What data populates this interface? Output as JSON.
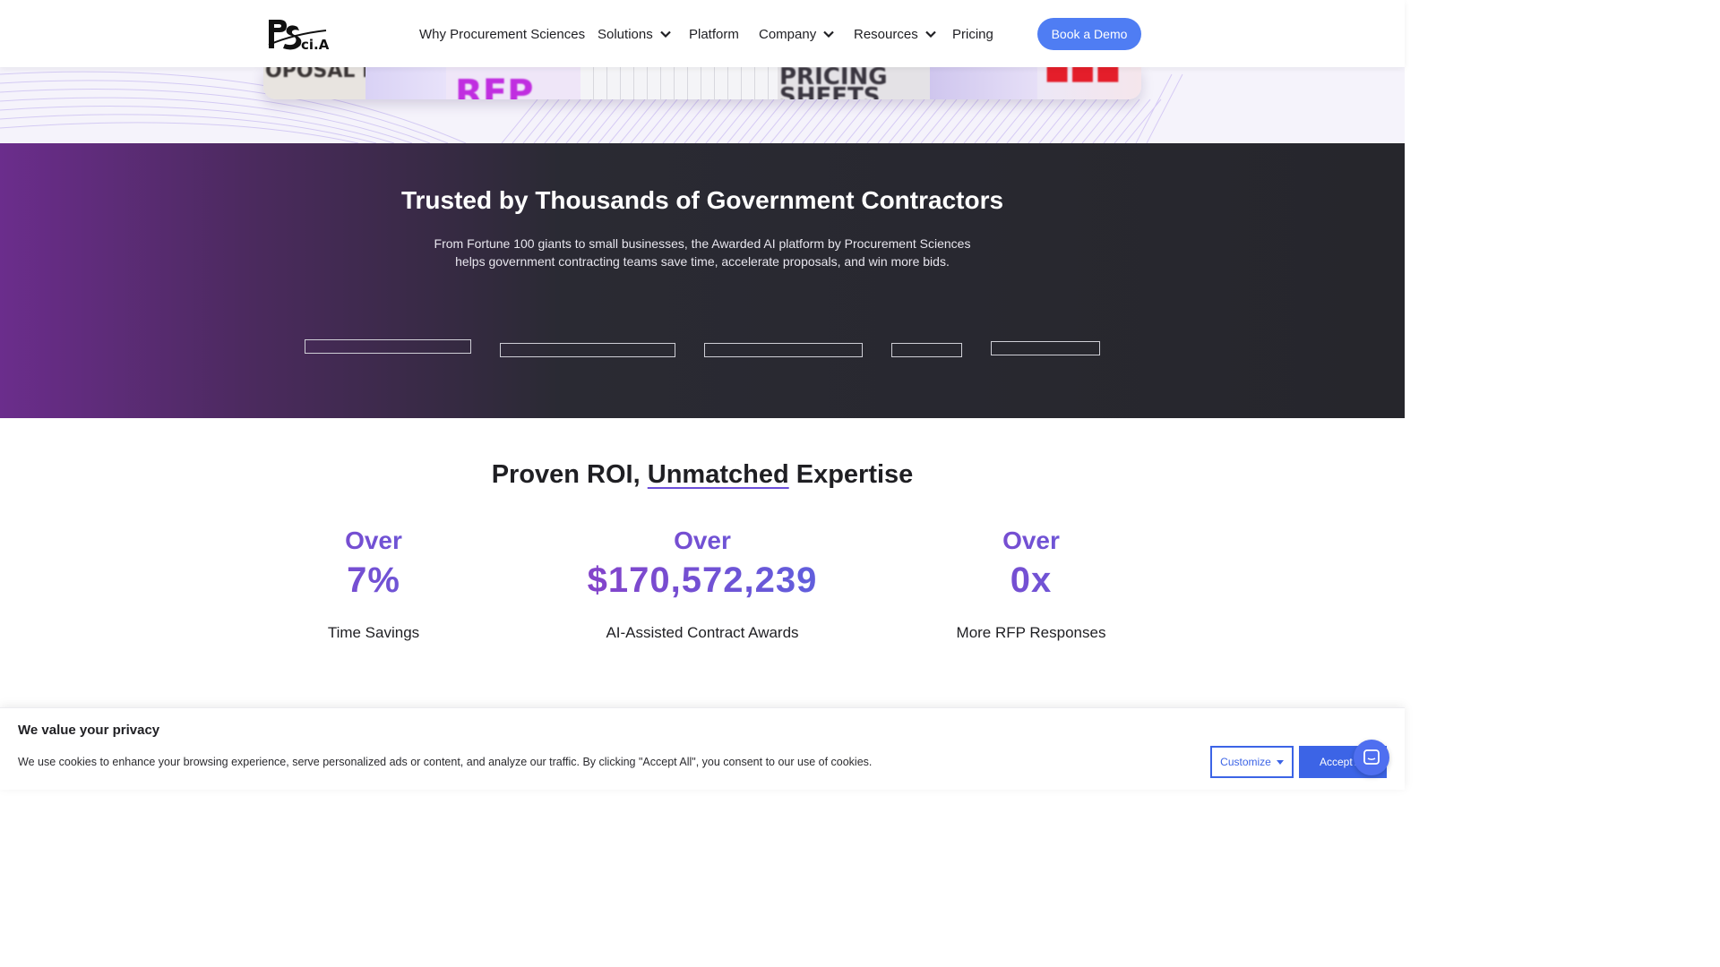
{
  "header": {
    "logo_text": "PS ci.AI",
    "nav": [
      {
        "label": "Why Procurement Sciences",
        "has_dropdown": false
      },
      {
        "label": "Solutions",
        "has_dropdown": true
      },
      {
        "label": "Platform",
        "has_dropdown": false
      },
      {
        "label": "Company",
        "has_dropdown": true
      },
      {
        "label": "Resources",
        "has_dropdown": true
      },
      {
        "label": "Pricing",
        "has_dropdown": false
      }
    ],
    "cta_label": "Book a Demo"
  },
  "hero": {
    "tiles": [
      "OPOSAL FATIGUE",
      "RFP",
      "PRICING SHEETS"
    ]
  },
  "trusted": {
    "title": "Trusted by Thousands of Government Contractors",
    "description": "From Fortune 100 giants to small businesses, the Awarded AI platform by Procurement Sciences helps government contracting teams save time, accelerate proposals, and win more bids."
  },
  "roi": {
    "title_prefix": "Proven ROI,",
    "title_underlined": "Unmatched",
    "title_suffix": "Expertise",
    "stats": [
      {
        "prefix": "Over",
        "value": "7%",
        "label": "Time Savings"
      },
      {
        "prefix": "Over",
        "value": "$170,572,239",
        "label": "AI-Assisted Contract Awards"
      },
      {
        "prefix": "Over",
        "value": "0x",
        "label": "More RFP Responses"
      }
    ]
  },
  "cookie": {
    "title": "We value your privacy",
    "text": "We use cookies to enhance your browsing experience, serve personalized ads or content, and analyze our traffic. By clicking \"Accept All\", you consent to our use of cookies.",
    "customize_label": "Customize",
    "accept_label": "Accept All"
  },
  "colors": {
    "accent": "#4f7df3",
    "cookie_button": "#3c64e6",
    "stat_gradient_start": "#8a3fc7",
    "stat_gradient_end": "#5b63e0"
  },
  "icons": {
    "dropdown": "chevron-down-icon",
    "chat": "chat-bubble-icon"
  }
}
